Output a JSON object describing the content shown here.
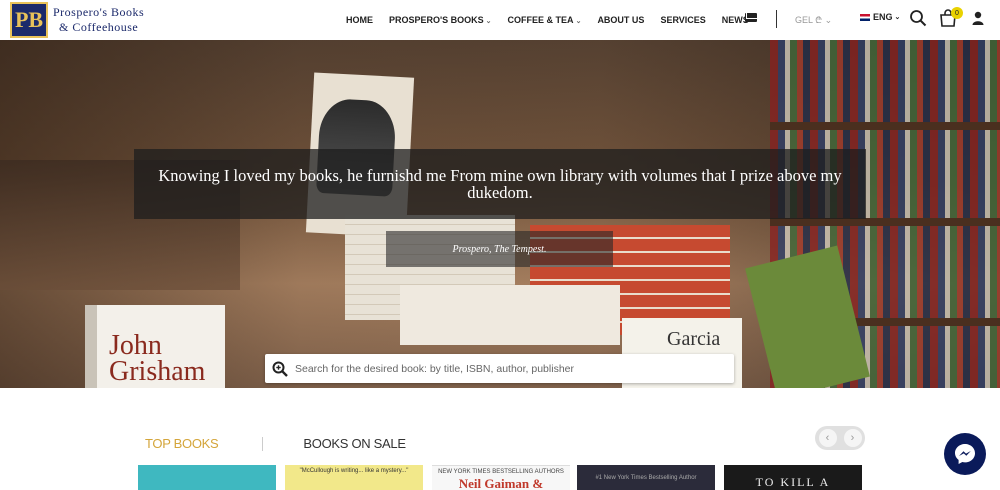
{
  "brand": {
    "mark": "PB",
    "line1": "Prospero's Books",
    "line2": "& Coffeehouse"
  },
  "nav": {
    "items": [
      {
        "label": "HOME",
        "dropdown": false
      },
      {
        "label": "PROSPERO'S BOOKS",
        "dropdown": true
      },
      {
        "label": "COFFEE & TEA",
        "dropdown": true
      },
      {
        "label": "ABOUT US",
        "dropdown": false
      },
      {
        "label": "SERVICES",
        "dropdown": false
      },
      {
        "label": "NEWS",
        "dropdown": false
      }
    ],
    "currency": "GEL ₾",
    "language": "ENG",
    "cart_count": "0"
  },
  "hero": {
    "quote": "Knowing I loved my books, he furnishd me From mine own library with volumes that I prize above my dukedom.",
    "attribution": "Prospero, The Tempest.",
    "search_placeholder": "Search for the desired book: by title, ISBN, author, publisher",
    "book_labels": {
      "grisham": "John Grisham",
      "garcia": "Garcia"
    }
  },
  "section": {
    "tabs": [
      {
        "label": "TOP BOOKS",
        "active": true
      },
      {
        "label": "BOOKS ON SALE",
        "active": false
      }
    ],
    "prev": "‹",
    "next": "›"
  },
  "cards": [
    {
      "caption": ""
    },
    {
      "caption": "\"McCullough is writing... like a mystery...\""
    },
    {
      "caption": "NEW YORK TIMES BESTSELLING AUTHORS",
      "title": "Neil Gaiman &"
    },
    {
      "caption": "#1 New York Times Bestselling Author"
    },
    {
      "title": "TO KILL A"
    }
  ],
  "colors": {
    "accent": "#d4a53a",
    "brand_blue": "#1c2a6b",
    "messenger": "#0a1a5a"
  }
}
